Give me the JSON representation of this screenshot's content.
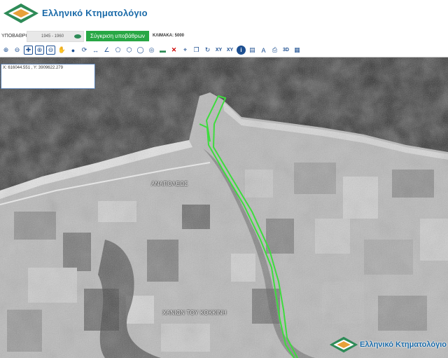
{
  "header": {
    "logo_text": "Ελληνικό Κτηματολόγιο"
  },
  "bar": {
    "background_label": "ΥΠΟΒΑΘΡΟ:",
    "background_value": "1945 - 1960",
    "compare_button": "Σύγκριση υποβάθρων",
    "scale_text": "ΚΛΙΜΑΚΑ: 5000"
  },
  "toolbar": {
    "icons": [
      "zoom-in-icon",
      "zoom-out-icon",
      "full-extent-icon",
      "zoom-box-icon",
      "zoom-box-out-icon",
      "pan-icon",
      "user-pin-icon",
      "refresh-icon",
      "measure-line-icon",
      "measure-angle-icon",
      "polygon-icon",
      "area-icon",
      "circle-icon",
      "target-icon",
      "screen-icon",
      "delete-icon",
      "measure-icon",
      "copy-icon",
      "rotate-icon",
      "xy-icon",
      "xy-search-icon",
      "info-icon",
      "layers-icon",
      "text-icon",
      "print-icon",
      "3d-icon",
      "legend-icon"
    ],
    "text_3d": "3D",
    "text_xy": "XY"
  },
  "coords": {
    "text": "X: 616044.551 , Y: 3909622.279"
  },
  "map_labels": {
    "place1": "ΑΝΑΠΟΛΕΩΣ",
    "place2": "ΧΑΝΙΩΝ ΤΟΥ ΚΟΚΚΙΝΗ"
  },
  "watermark": {
    "text": "Ελληνικό Κτηματολόγιο"
  },
  "colors": {
    "brand_blue": "#1a6aa8",
    "logo_green": "#2e8b57",
    "logo_orange": "#e8a13a",
    "compare_green": "#28a745",
    "parcel_line": "#3ddc3d"
  }
}
